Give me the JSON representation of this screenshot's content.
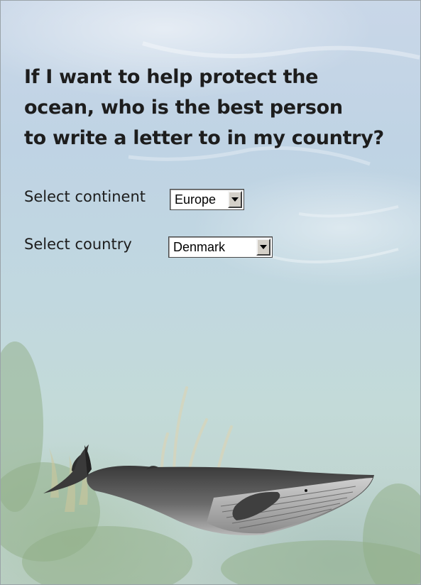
{
  "question": {
    "line1": "If I want to help protect the",
    "line2": "ocean, who is the best person",
    "line3": "to write a letter to in my country?"
  },
  "form": {
    "continent_label": "Select continent",
    "continent_value": "Europe",
    "country_label": "Select country",
    "country_value": "Denmark"
  },
  "icons": {
    "dropdown_arrow": "chevron-down-icon",
    "illustration": "whale-illustration"
  }
}
